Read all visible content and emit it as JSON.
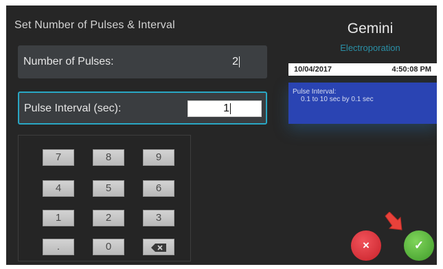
{
  "dialog": {
    "title": "Set Number of Pulses & Interval"
  },
  "fields": {
    "pulses": {
      "label": "Number of Pulses:",
      "value": "2"
    },
    "interval": {
      "label": "Pulse Interval (sec):",
      "value": "1"
    }
  },
  "keypad": {
    "keys": [
      "7",
      "8",
      "9",
      "4",
      "5",
      "6",
      "1",
      "2",
      "3",
      ".",
      "0"
    ],
    "backspace_icon": "backspace-icon"
  },
  "brand": {
    "name": "Gemini",
    "subtitle": "Electroporation"
  },
  "status": {
    "date": "10/04/2017",
    "time": "4:50:08 PM"
  },
  "info": {
    "title": "Pulse Interval:",
    "text": "0.1 to 10 sec by 0.1 sec"
  },
  "actions": {
    "cancel_symbol": "×",
    "confirm_symbol": "✓"
  },
  "colors": {
    "screen_bg": "#262626",
    "accent": "#29a7c4",
    "info_bg": "#2a44b3",
    "cancel": "#d9353b",
    "confirm": "#58b63a",
    "pointer": "#e8413a"
  }
}
